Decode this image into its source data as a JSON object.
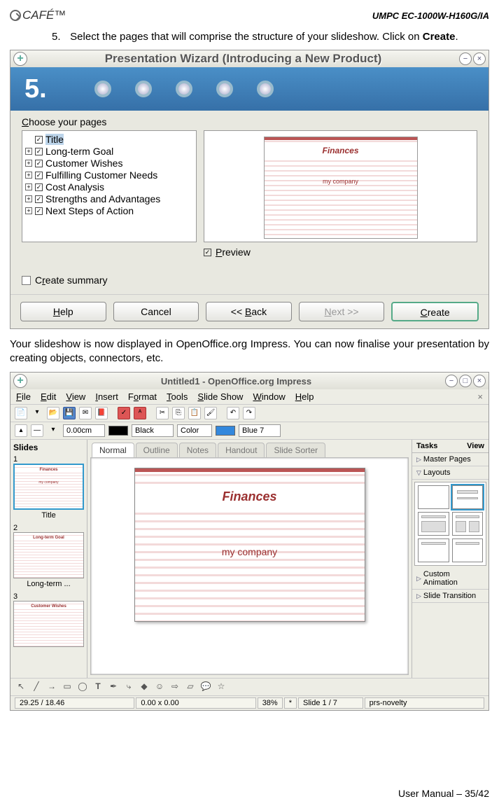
{
  "header": {
    "logo": "CAFÉ™",
    "model": "UMPC EC-1000W-H160G/IA"
  },
  "step": {
    "num": "5.",
    "text1": "Select the pages that will comprise the structure of your slideshow. Click on ",
    "bold": "Create",
    "text2": "."
  },
  "wizard": {
    "title": "Presentation Wizard (Introducing a New Product)",
    "stepnum": "5.",
    "choose_c": "C",
    "choose_rest": "hoose your pages",
    "pages": [
      "Title",
      "Long-term Goal",
      "Customer Wishes",
      "Fulfilling Customer Needs",
      "Cost Analysis",
      "Strengths and Advantages",
      "Next Steps of Action"
    ],
    "preview": {
      "title": "Finances",
      "sub": "my company"
    },
    "preview_p": "P",
    "preview_rest": "review",
    "summary_r": "r",
    "summary_pre": "C",
    "summary_rest": "eate summary",
    "buttons": {
      "help_h": "H",
      "help_rest": "elp",
      "cancel": "Cancel",
      "back_pre": "<< ",
      "back_b": "B",
      "back_rest": "ack",
      "next_n": "N",
      "next_rest": "ext >>",
      "create_c": "C",
      "create_rest": "reate"
    }
  },
  "body_text": "Your slideshow is now displayed in OpenOffice.org Impress. You can now finalise your presentation by creating objects, connectors, etc.",
  "impress": {
    "title": "Untitled1 - OpenOffice.org Impress",
    "menu": {
      "file": "File",
      "edit": "Edit",
      "view": "View",
      "insert": "Insert",
      "format": "Format",
      "tools": "Tools",
      "slideshow": "Slide Show",
      "window": "Window",
      "help": "Help"
    },
    "tb2": {
      "size": "0.00cm",
      "color1": "Black",
      "color2": "Color",
      "color3": "Blue 7"
    },
    "slides": {
      "hdr": "Slides",
      "t1": "Finances",
      "t1s": "my company",
      "l1": "Title",
      "t2": "Long-term Goal",
      "l2": "Long-term ...",
      "t3": "Customer Wishes"
    },
    "tabs": [
      "Normal",
      "Outline",
      "Notes",
      "Handout",
      "Slide Sorter"
    ],
    "slide": {
      "title": "Finances",
      "sub": "my company"
    },
    "tasks": {
      "hdr": "Tasks",
      "view": "View",
      "mp": "Master Pages",
      "lay": "Layouts",
      "ca": "Custom Animation",
      "st": "Slide Transition"
    },
    "status": {
      "pos": "29.25 / 18.46",
      "sz": "0.00 x 0.00",
      "zoom": "38%",
      "star": "*",
      "slide": "Slide 1 / 7",
      "tpl": "prs-novelty"
    }
  },
  "footer": "User Manual – 35/42"
}
